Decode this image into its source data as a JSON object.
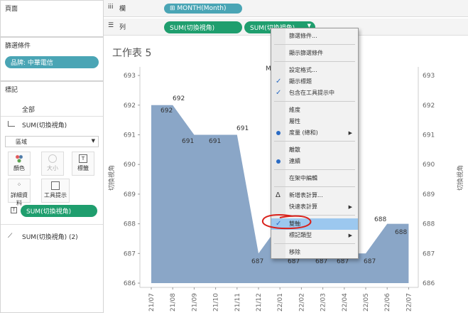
{
  "left_panel": {
    "pages_title": "頁面",
    "filters_title": "篩選條件",
    "filter_pill": "品牌: 中華電信",
    "marks_title": "標記",
    "all_label": "全部",
    "marks_item": "SUM(切換視角)",
    "mark_type": "區域",
    "cards": {
      "color": "顏色",
      "size": "大小",
      "label": "標籤",
      "detail": "詳細資料",
      "tooltip": "工具提示"
    },
    "marks_pill": "SUM(切換視角)",
    "second_marks": "SUM(切換視角) (2)"
  },
  "shelves": {
    "columns_label": "欄",
    "rows_label": "列",
    "columns_pill": "⊞ MONTH(Month)",
    "rows_pill_1": "SUM(切換視角)",
    "rows_pill_2": "SUM(切換視角)"
  },
  "sheet_title": "工作表 5",
  "header_partial": "M",
  "context_menu": {
    "items": [
      {
        "label": "篩選條件...",
        "mark": "",
        "arrow": ""
      },
      {
        "label": "顯示篩選條件",
        "mark": "",
        "arrow": ""
      },
      {
        "label": "設定格式...",
        "mark": "",
        "arrow": ""
      },
      {
        "label": "顯示標題",
        "mark": "check",
        "arrow": ""
      },
      {
        "label": "包含在工具提示中",
        "mark": "check",
        "arrow": ""
      },
      {
        "label": "維度",
        "mark": "",
        "arrow": ""
      },
      {
        "label": "屬性",
        "mark": "",
        "arrow": ""
      },
      {
        "label": "度量 (總和)",
        "mark": "dot",
        "arrow": "▶"
      },
      {
        "label": "離散",
        "mark": "",
        "arrow": ""
      },
      {
        "label": "連續",
        "mark": "dot",
        "arrow": ""
      },
      {
        "label": "在架中編輯",
        "mark": "",
        "arrow": ""
      },
      {
        "label": "新增表計算...",
        "mark": "delta",
        "arrow": ""
      },
      {
        "label": "快速表計算",
        "mark": "",
        "arrow": "▶"
      },
      {
        "label": "雙軸",
        "mark": "check",
        "arrow": ""
      },
      {
        "label": "標記類型",
        "mark": "",
        "arrow": "▶"
      },
      {
        "label": "移除",
        "mark": "",
        "arrow": ""
      }
    ],
    "highlighted_index": 13
  },
  "chart_data": {
    "type": "area",
    "categories": [
      "21/07",
      "21/08",
      "21/09",
      "21/10",
      "21/11",
      "21/12",
      "22/01",
      "22/02",
      "22/03",
      "22/04",
      "22/05",
      "22/06",
      "22/07"
    ],
    "values": [
      692,
      692,
      691,
      691,
      691,
      687,
      688,
      687,
      687,
      687,
      687,
      688,
      688
    ],
    "data_labels": [
      "692",
      "692",
      "691",
      "691",
      "691",
      "687",
      "",
      "687",
      "687",
      "687",
      "687",
      "688",
      "688"
    ],
    "ylabel": "切換視角",
    "ylabel_right": "切換視角",
    "yticks": [
      686,
      687,
      688,
      689,
      690,
      691,
      692,
      693
    ],
    "ylim": [
      686,
      693.5
    ],
    "fill_color": "#8aa6c7"
  }
}
